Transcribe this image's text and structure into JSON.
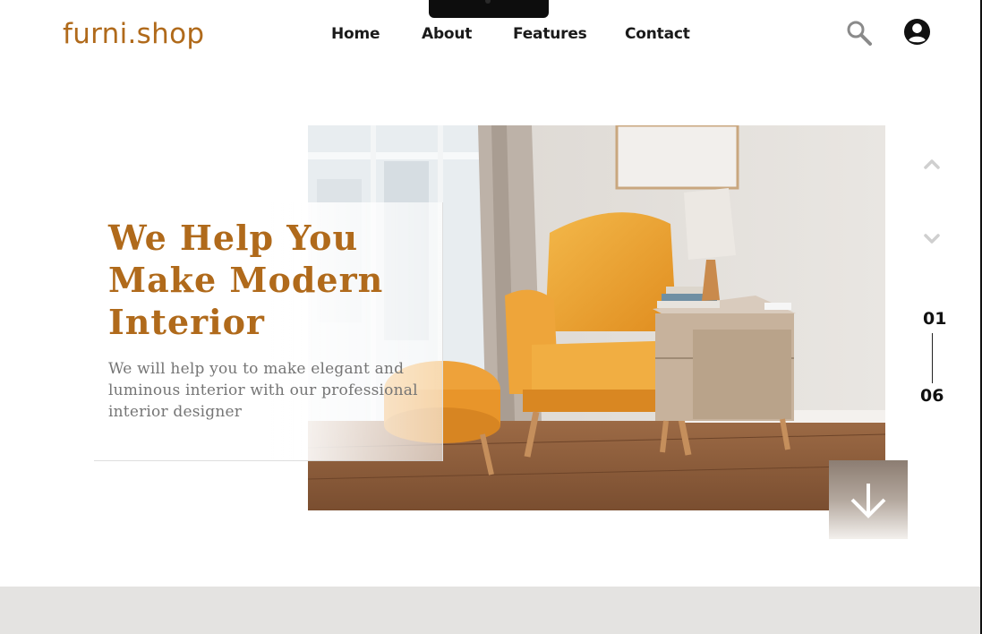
{
  "brand": {
    "logo_text": "furni.shop",
    "accent_color": "#b06a1b"
  },
  "nav": {
    "items": [
      {
        "label": "Home"
      },
      {
        "label": "About"
      },
      {
        "label": "Features"
      },
      {
        "label": "Contact"
      }
    ]
  },
  "header_actions": {
    "search_icon": "search-icon",
    "account_icon": "user-circle-icon"
  },
  "hero": {
    "title": "We Help You Make Modern Interior",
    "subtitle": "We will help you to make elegant and luminous interior with our professional interior designer",
    "image_subject": "yellow armchair beside wooden nightstand with lamp",
    "scroll_icon": "arrow-down-icon"
  },
  "slider": {
    "current": "01",
    "total": "06",
    "up_icon": "chevron-up-icon",
    "down_icon": "chevron-down-icon"
  }
}
